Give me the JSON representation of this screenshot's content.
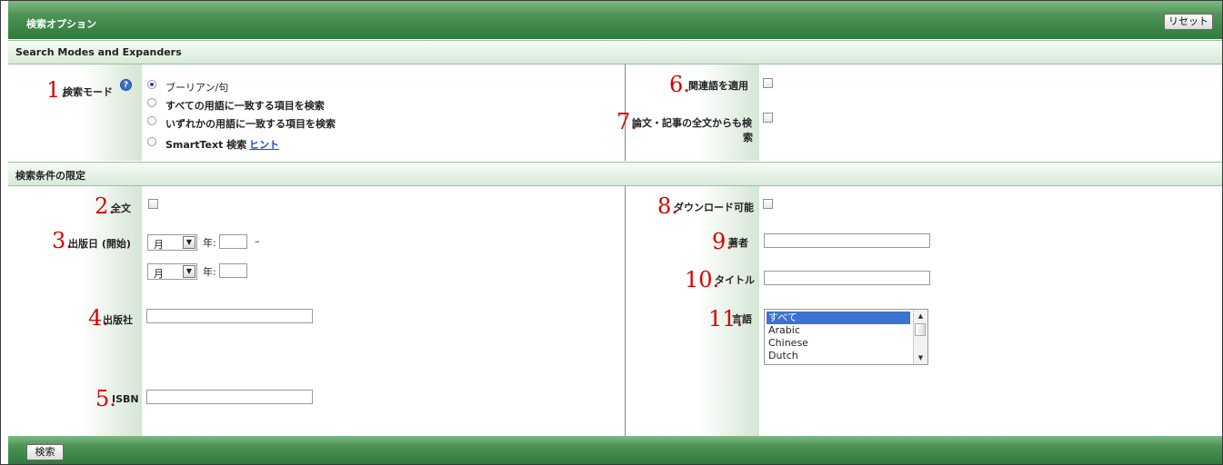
{
  "header": {
    "title": "検索オプション",
    "reset_label": "リセット"
  },
  "section1": {
    "title": "Search Modes and Expanders",
    "search_mode": {
      "number": "1.",
      "label": "検索モード",
      "options": [
        {
          "label": "ブーリアン/句",
          "selected": true
        },
        {
          "label": "すべての用語に一致する項目を検索",
          "selected": false
        },
        {
          "label": "いずれかの用語に一致する項目を検索",
          "selected": false
        },
        {
          "label": "SmartText 検索",
          "selected": false,
          "link": "ヒント"
        }
      ]
    },
    "related_words": {
      "number": "6.",
      "label": "関連語を適用"
    },
    "fulltext_search": {
      "number": "7.",
      "label_line1": "論文・記事の全文からも検",
      "label_line2": "索"
    }
  },
  "section2": {
    "title": "検索条件の限定",
    "fulltext": {
      "number": "2.",
      "label": "全文"
    },
    "pub_date": {
      "number": "3.",
      "label": "出版日 (開始)",
      "month_value": "月",
      "year_label": "年:",
      "dash": "–"
    },
    "publisher": {
      "number": "4.",
      "label": "出版社"
    },
    "isbn": {
      "number": "5.",
      "label": "ISBN"
    },
    "downloadable": {
      "number": "8.",
      "label": "ダウンロード可能"
    },
    "author": {
      "number": "9.",
      "label": "著者"
    },
    "title_field": {
      "number": "10.",
      "label": "タイトル"
    },
    "language": {
      "number": "11.",
      "label": "言語",
      "options": [
        "すべて",
        "Arabic",
        "Chinese",
        "Dutch"
      ],
      "selected": "すべて"
    }
  },
  "footer": {
    "search_label": "検索"
  }
}
